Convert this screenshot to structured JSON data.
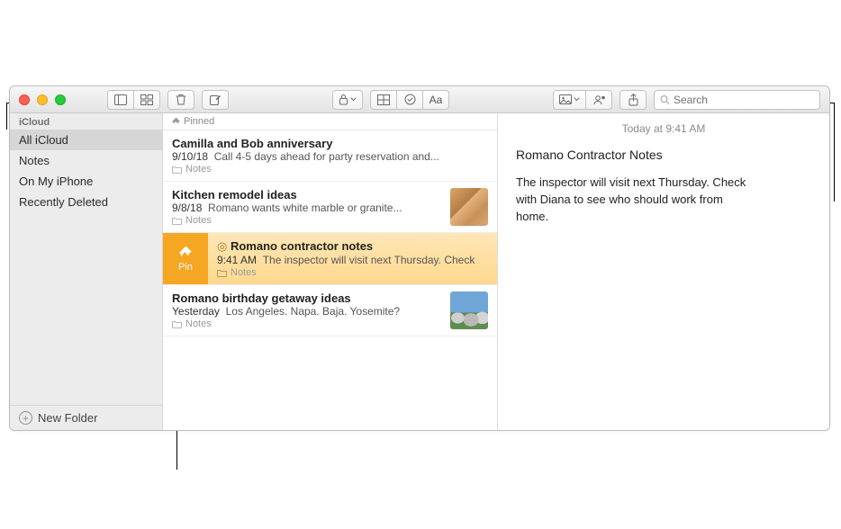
{
  "sidebar": {
    "header": "iCloud",
    "items": [
      {
        "label": "All iCloud"
      },
      {
        "label": "Notes"
      },
      {
        "label": "On My iPhone"
      },
      {
        "label": "Recently Deleted"
      }
    ],
    "new_folder": "New Folder"
  },
  "list": {
    "pinned_label": "Pinned",
    "notes": [
      {
        "title": "Camilla and Bob anniversary",
        "date": "9/10/18",
        "preview": "Call 4-5 days ahead for party reservation and...",
        "folder": "Notes"
      },
      {
        "title": "Kitchen remodel ideas",
        "date": "9/8/18",
        "preview": "Romano wants white marble or granite...",
        "folder": "Notes"
      },
      {
        "title": "Romano contractor notes",
        "date": "9:41 AM",
        "preview": "The inspector will visit next Thursday. Check",
        "folder": "Notes"
      },
      {
        "title": "Romano birthday getaway ideas",
        "date": "Yesterday",
        "preview": "Los Angeles. Napa. Baja. Yosemite?",
        "folder": "Notes"
      }
    ],
    "pin_action": "Pin"
  },
  "detail": {
    "timestamp": "Today at 9:41 AM",
    "title": "Romano Contractor Notes",
    "body": "The inspector will visit next Thursday. Check with Diana to see who should work from home."
  },
  "search": {
    "placeholder": "Search"
  },
  "toolbar": {
    "font_label": "Aa"
  }
}
